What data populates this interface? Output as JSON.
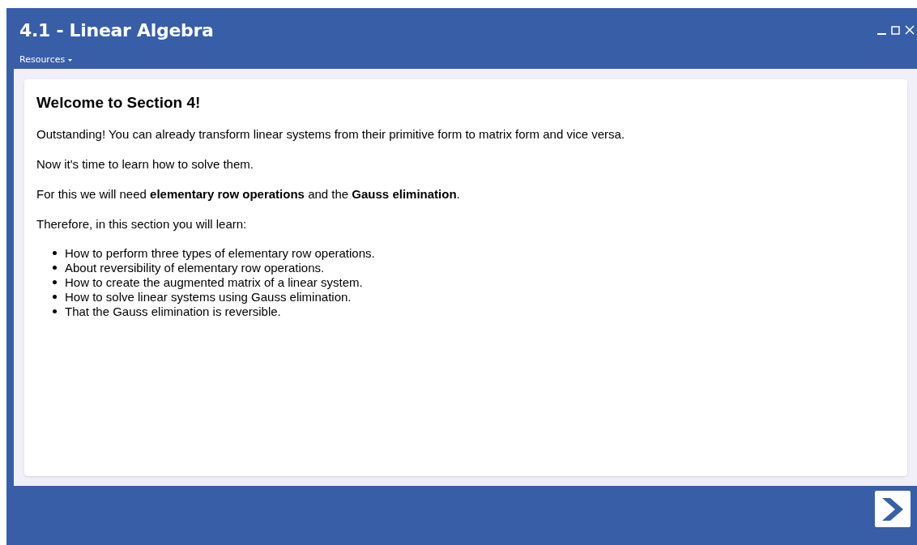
{
  "window": {
    "title": "4.1 - Linear Algebra"
  },
  "menu": {
    "label": "Resources"
  },
  "content": {
    "heading": "Welcome to Section 4!",
    "paragraphs": [
      "Outstanding! You can already transform linear systems from their primitive form to matrix form and vice versa.",
      "Now it's time to learn how to solve them.",
      "For this we will need **elementary row operations** and the **Gauss elimination**.",
      "Therefore, in this section you will learn:"
    ],
    "bullets": [
      "How to perform three types of elementary row operations.",
      "About reversibility of elementary row operations.",
      "How to create the augmented matrix of a linear system.",
      "How to solve linear systems using Gauss elimination.",
      "That the Gauss elimination is reversible."
    ]
  }
}
